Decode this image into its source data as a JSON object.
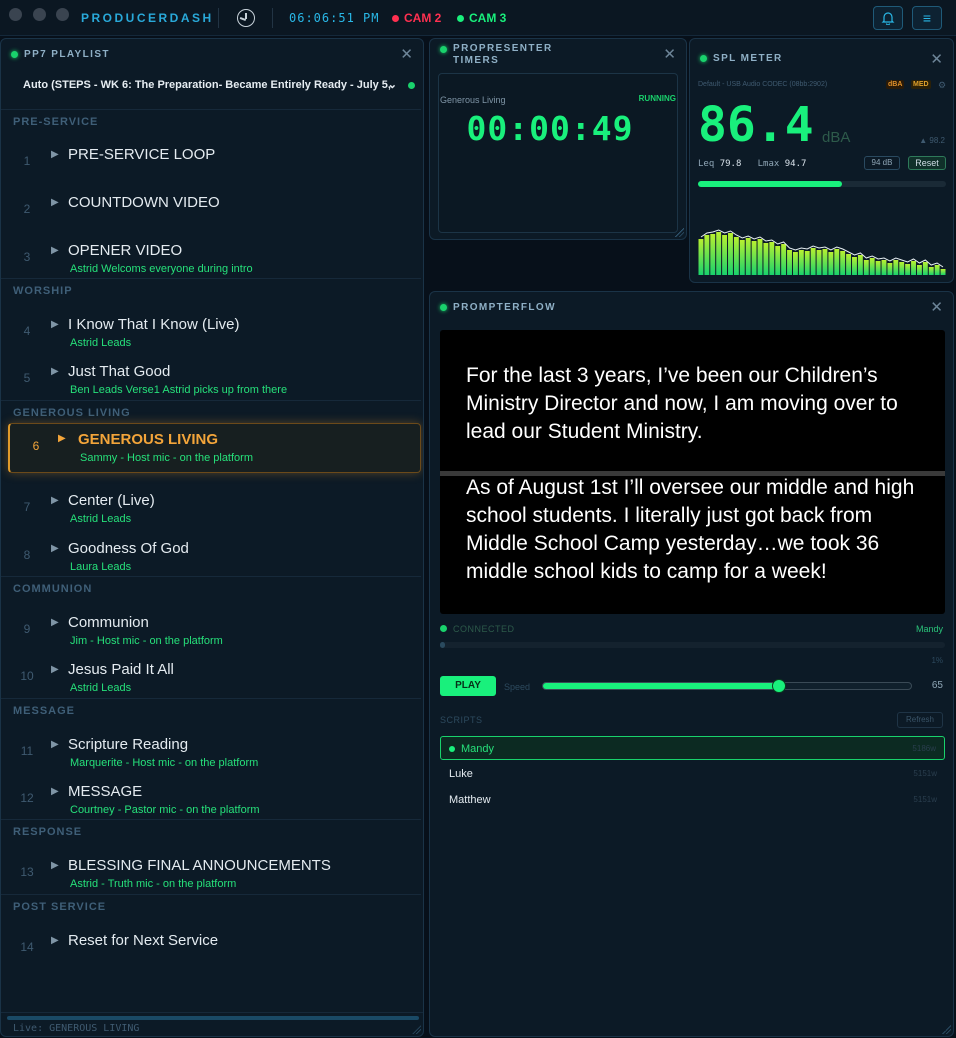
{
  "topbar": {
    "brand": "PRODUCERDASH",
    "clock": "06:06:51 PM",
    "cam2": {
      "label": "CAM 2",
      "color": "#ff3050"
    },
    "cam3": {
      "label": "CAM 3",
      "color": "#19f07c"
    },
    "bell_icon": "bell-icon",
    "menu_icon": "menu-icon",
    "menu_glyph": "≡"
  },
  "playlist": {
    "title": "PP7 PLAYLIST",
    "selected_playlist": "Auto (STEPS - WK 6: The Preparation- Became Entirely Ready - July 5,",
    "sections": [
      {
        "title": "PRE-SERVICE",
        "items": [
          {
            "num": "1",
            "name": "PRE-SERVICE LOOP",
            "sub": ""
          },
          {
            "num": "2",
            "name": "COUNTDOWN VIDEO",
            "sub": ""
          },
          {
            "num": "3",
            "name": "OPENER VIDEO",
            "sub": "Astrid Welcoms everyone during intro"
          }
        ]
      },
      {
        "title": "WORSHIP",
        "items": [
          {
            "num": "4",
            "name": "I Know That I Know (Live)",
            "sub": "Astrid Leads"
          },
          {
            "num": "5",
            "name": "Just That Good",
            "sub": "Ben Leads Verse1 Astrid picks up from there"
          }
        ]
      },
      {
        "title": "GENEROUS LIVING",
        "items": [
          {
            "num": "6",
            "name": "GENEROUS LIVING",
            "sub": "Sammy - Host mic - on the platform",
            "live": true
          },
          {
            "num": "7",
            "name": "Center (Live)",
            "sub": "Astrid Leads"
          },
          {
            "num": "8",
            "name": "Goodness Of God",
            "sub": "Laura Leads"
          }
        ]
      },
      {
        "title": "COMMUNION",
        "items": [
          {
            "num": "9",
            "name": "Communion",
            "sub": "Jim - Host mic - on the platform"
          },
          {
            "num": "10",
            "name": "Jesus Paid It All",
            "sub": "Astrid Leads"
          }
        ]
      },
      {
        "title": "MESSAGE",
        "items": [
          {
            "num": "11",
            "name": "Scripture Reading",
            "sub": "Marquerite - Host mic - on the platform"
          },
          {
            "num": "12",
            "name": "MESSAGE",
            "sub": "Courtney - Pastor mic - on the platform"
          }
        ]
      },
      {
        "title": "RESPONSE",
        "items": [
          {
            "num": "13",
            "name": "BLESSING FINAL ANNOUNCEMENTS",
            "sub": "Astrid - Truth mic - on the platform"
          }
        ]
      },
      {
        "title": "POST SERVICE",
        "items": [
          {
            "num": "14",
            "name": "Reset for Next Service",
            "sub": ""
          }
        ]
      }
    ],
    "footer": "Live: GENEROUS LIVING"
  },
  "timers": {
    "title": "PROPRESENTER TIMERS",
    "label": "Generous Living",
    "status": "RUNNING",
    "value": "00:00:49"
  },
  "spl": {
    "title": "SPL METER",
    "device": "Default - USB Audio CODEC (08bb:2902)",
    "badge_dba": "dBA",
    "badge_med": "MED",
    "value": "86.4",
    "unit": "dBA",
    "peak": "▲ 98.2",
    "leq_label": "Leq",
    "leq": "79.8",
    "lmax_label": "Lmax",
    "lmax": "94.7",
    "cal_button": "94 dB",
    "reset_button": "Reset",
    "level_fraction": 0.58,
    "history": [
      0.72,
      0.8,
      0.82,
      0.86,
      0.8,
      0.84,
      0.76,
      0.7,
      0.74,
      0.68,
      0.72,
      0.64,
      0.66,
      0.58,
      0.62,
      0.5,
      0.46,
      0.5,
      0.48,
      0.54,
      0.5,
      0.52,
      0.46,
      0.52,
      0.48,
      0.42,
      0.36,
      0.4,
      0.3,
      0.34,
      0.28,
      0.3,
      0.24,
      0.3,
      0.26,
      0.22,
      0.28,
      0.2,
      0.26,
      0.16,
      0.2,
      0.12
    ]
  },
  "prompter": {
    "title": "PROMPTERFLOW",
    "paragraph1": "For the last 3 years, I’ve been our Children’s Ministry Director and now, I am moving over to lead our Student Ministry.",
    "paragraph2": "As of August 1st I’ll oversee our middle and high school students. I literally just got back from Middle School Camp yesterday…we took 36 middle school kids to camp for a week!",
    "status": "CONNECTED",
    "user": "Mandy",
    "progress_label": "1%",
    "progress": 0.01,
    "play_label": "PLAY",
    "speed_label": "Speed",
    "speed": 65,
    "speed_fraction": 0.64,
    "scripts_label": "SCRIPTS",
    "refresh_label": "Refresh",
    "scripts": [
      {
        "name": "Mandy",
        "words": "5186w",
        "selected": true
      },
      {
        "name": "Luke",
        "words": "5151w"
      },
      {
        "name": "Matthew",
        "words": "5151w"
      }
    ]
  }
}
